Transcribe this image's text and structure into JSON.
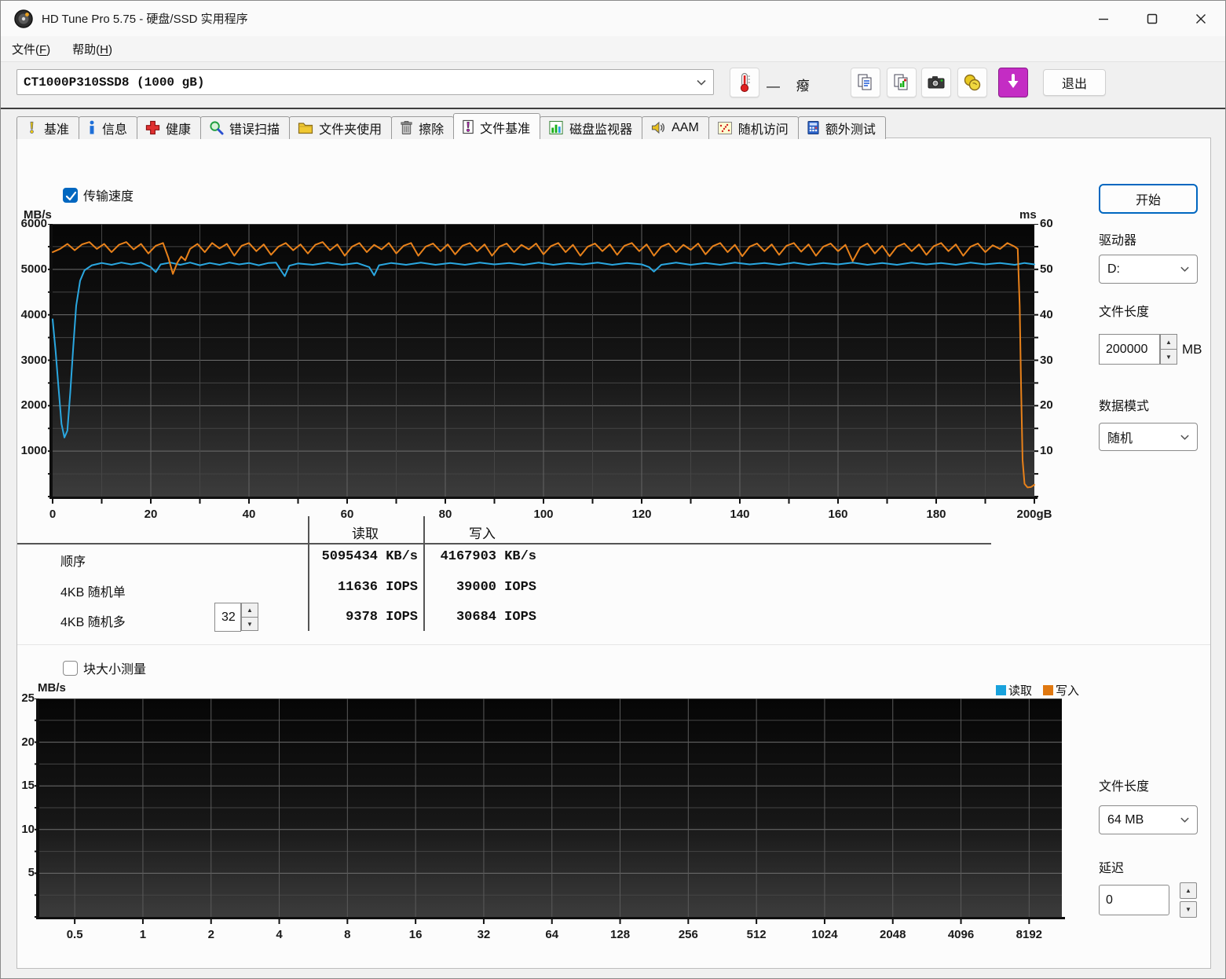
{
  "window": {
    "title": "HD Tune Pro 5.75 - 硬盘/SSD 实用程序"
  },
  "menu": {
    "items": [
      {
        "pre": "文件(",
        "key": "F",
        "post": ")"
      },
      {
        "pre": "帮助(",
        "key": "H",
        "post": ")"
      }
    ]
  },
  "toolbar": {
    "drive_select": "CT1000P310SSD8 (1000 gB)",
    "temp_text": "— 癈",
    "exit_label": "退出"
  },
  "tabs": {
    "active_index": 6,
    "items": [
      {
        "label": "基准"
      },
      {
        "label": "信息"
      },
      {
        "label": "健康"
      },
      {
        "label": "错误扫描"
      },
      {
        "label": "文件夹使用"
      },
      {
        "label": "擦除"
      },
      {
        "label": "文件基准"
      },
      {
        "label": "磁盘监视器"
      },
      {
        "label": "AAM"
      },
      {
        "label": "随机访问"
      },
      {
        "label": "额外测试"
      }
    ]
  },
  "benchmark": {
    "transfer_checkbox": "传输速度",
    "results": {
      "read_header": "读取",
      "write_header": "写入",
      "rows": [
        {
          "label": "顺序",
          "read": "5095434 KB/s",
          "write": "4167903 KB/s"
        },
        {
          "label": "4KB 随机单",
          "read": "11636 IOPS",
          "write": "39000 IOPS"
        },
        {
          "label": "4KB 随机多",
          "read": "9378 IOPS",
          "write": "30684 IOPS"
        }
      ],
      "queue_depth": "32"
    }
  },
  "blocksize_section": {
    "checkbox": "块大小测量"
  },
  "sidebar": {
    "start_label": "开始",
    "drive_label": "驱动器",
    "drive_value": "D:",
    "file_length_label": "文件长度",
    "file_length_value": "200000",
    "file_length_unit": "MB",
    "data_mode_label": "数据模式",
    "data_mode_value": "随机",
    "file_length2_label": "文件长度",
    "file_length2_value": "64 MB",
    "delay_label": "延迟",
    "delay_value": "0"
  },
  "colors": {
    "read_line": "#2aa7e0",
    "write_line": "#e8811a",
    "legend_read": "#19a2dc",
    "legend_write": "#e07810",
    "accent_blue": "#0067c0",
    "download_btn": "#c42cc4"
  },
  "chart_data": [
    {
      "id": "transfer",
      "type": "line",
      "title": "传输速度",
      "y_left": {
        "unit": "MB/s",
        "min": 0,
        "max": 6000,
        "minor_step": 500,
        "major_step": 1000,
        "ticks": [
          "6000",
          "5000",
          "4000",
          "3000",
          "2000",
          "1000"
        ]
      },
      "y_right": {
        "unit": "ms",
        "min": 0,
        "max": 60,
        "minor_step": 5,
        "ticks": [
          "60",
          "50",
          "40",
          "30",
          "20",
          "10"
        ]
      },
      "x": {
        "min": 0,
        "max": 200,
        "minor_step": 10,
        "major_step": 20,
        "ticks": [
          "0",
          "20",
          "40",
          "60",
          "80",
          "100",
          "120",
          "140",
          "160",
          "180",
          "200gB"
        ]
      },
      "legend_position": "none",
      "grid": true,
      "series": [
        {
          "name": "读取",
          "color": "#2aa7e0",
          "points": [
            [
              0,
              3900
            ],
            [
              0.6,
              3200
            ],
            [
              1.2,
              2400
            ],
            [
              1.8,
              1600
            ],
            [
              2.4,
              1300
            ],
            [
              3,
              1450
            ],
            [
              3.6,
              2300
            ],
            [
              4.2,
              3300
            ],
            [
              4.8,
              4200
            ],
            [
              5.6,
              4750
            ],
            [
              6.5,
              4980
            ],
            [
              8,
              5090
            ],
            [
              10,
              5140
            ],
            [
              12,
              5100
            ],
            [
              14,
              5150
            ],
            [
              16,
              5110
            ],
            [
              18,
              5150
            ],
            [
              20,
              5050
            ],
            [
              21,
              4940
            ],
            [
              22,
              5110
            ],
            [
              24,
              5150
            ],
            [
              26,
              5100
            ],
            [
              28,
              5150
            ],
            [
              30,
              5090
            ],
            [
              32,
              5140
            ],
            [
              34,
              5100
            ],
            [
              36,
              5150
            ],
            [
              38,
              5110
            ],
            [
              40,
              5140
            ],
            [
              42,
              5090
            ],
            [
              44,
              5140
            ],
            [
              45.5,
              5150
            ],
            [
              46.5,
              4980
            ],
            [
              47.3,
              4850
            ],
            [
              48.2,
              5080
            ],
            [
              50,
              5130
            ],
            [
              53,
              5100
            ],
            [
              56,
              5150
            ],
            [
              59,
              5100
            ],
            [
              62,
              5140
            ],
            [
              64.5,
              5050
            ],
            [
              65.5,
              4870
            ],
            [
              66.5,
              5090
            ],
            [
              69,
              5140
            ],
            [
              72,
              5100
            ],
            [
              75,
              5150
            ],
            [
              78,
              5100
            ],
            [
              81,
              5140
            ],
            [
              84,
              5100
            ],
            [
              87,
              5150
            ],
            [
              90,
              5110
            ],
            [
              93,
              5140
            ],
            [
              96,
              5100
            ],
            [
              99,
              5150
            ],
            [
              102,
              5100
            ],
            [
              105,
              5140
            ],
            [
              108,
              5110
            ],
            [
              111,
              5150
            ],
            [
              114,
              5100
            ],
            [
              117,
              5140
            ],
            [
              120,
              5110
            ],
            [
              121.5,
              5050
            ],
            [
              122.5,
              4950
            ],
            [
              124,
              5100
            ],
            [
              127,
              5150
            ],
            [
              130,
              5100
            ],
            [
              133,
              5140
            ],
            [
              136,
              5100
            ],
            [
              139,
              5150
            ],
            [
              142,
              5110
            ],
            [
              145,
              5140
            ],
            [
              148,
              5100
            ],
            [
              151,
              5150
            ],
            [
              154,
              5100
            ],
            [
              157,
              5140
            ],
            [
              160,
              5110
            ],
            [
              163,
              5150
            ],
            [
              166,
              5100
            ],
            [
              169,
              5140
            ],
            [
              172,
              5100
            ],
            [
              175,
              5150
            ],
            [
              178,
              5110
            ],
            [
              181,
              5140
            ],
            [
              184,
              5100
            ],
            [
              187,
              5150
            ],
            [
              190,
              5110
            ],
            [
              193,
              5140
            ],
            [
              196,
              5100
            ],
            [
              198,
              5140
            ],
            [
              200,
              5110
            ]
          ]
        },
        {
          "name": "写入",
          "color": "#e8811a",
          "points": [
            [
              0,
              5380
            ],
            [
              1.5,
              5450
            ],
            [
              3,
              5560
            ],
            [
              4.5,
              5420
            ],
            [
              6,
              5550
            ],
            [
              7.5,
              5600
            ],
            [
              9,
              5450
            ],
            [
              10.5,
              5560
            ],
            [
              12,
              5380
            ],
            [
              13.5,
              5540
            ],
            [
              15,
              5600
            ],
            [
              16.5,
              5440
            ],
            [
              18,
              5560
            ],
            [
              19.5,
              5350
            ],
            [
              21,
              5520
            ],
            [
              22.5,
              5580
            ],
            [
              23.6,
              5250
            ],
            [
              24.5,
              4900
            ],
            [
              25.4,
              5150
            ],
            [
              26.2,
              5280
            ],
            [
              27,
              5200
            ],
            [
              28,
              5450
            ],
            [
              29.5,
              5560
            ],
            [
              31,
              5380
            ],
            [
              32.5,
              5580
            ],
            [
              34,
              5460
            ],
            [
              35.5,
              5560
            ],
            [
              37,
              5300
            ],
            [
              38.5,
              5520
            ],
            [
              40,
              5580
            ],
            [
              41.5,
              5400
            ],
            [
              43,
              5550
            ],
            [
              44.5,
              5320
            ],
            [
              46,
              5500
            ],
            [
              47.5,
              5580
            ],
            [
              49,
              5420
            ],
            [
              50.5,
              5550
            ],
            [
              52,
              5350
            ],
            [
              53.5,
              5540
            ],
            [
              55,
              5600
            ],
            [
              56.5,
              5420
            ],
            [
              58,
              5550
            ],
            [
              59.5,
              5300
            ],
            [
              61,
              5500
            ],
            [
              62.5,
              5580
            ],
            [
              64,
              5380
            ],
            [
              65.5,
              5540
            ],
            [
              67,
              5440
            ],
            [
              68.5,
              5580
            ],
            [
              70,
              5350
            ],
            [
              71.5,
              5520
            ],
            [
              73,
              5580
            ],
            [
              74.5,
              5300
            ],
            [
              76,
              5500
            ],
            [
              77.5,
              5570
            ],
            [
              79,
              5400
            ],
            [
              80.5,
              5550
            ],
            [
              82,
              5330
            ],
            [
              83.5,
              5520
            ],
            [
              85,
              5580
            ],
            [
              86.5,
              5400
            ],
            [
              88,
              5550
            ],
            [
              89.5,
              5300
            ],
            [
              91,
              5500
            ],
            [
              92.5,
              5570
            ],
            [
              94,
              5380
            ],
            [
              95.5,
              5540
            ],
            [
              97,
              5440
            ],
            [
              98.5,
              5570
            ],
            [
              100,
              5330
            ],
            [
              101.5,
              5510
            ],
            [
              103,
              5580
            ],
            [
              104.5,
              5380
            ],
            [
              106,
              5540
            ],
            [
              107.5,
              5300
            ],
            [
              109,
              5500
            ],
            [
              110.5,
              5570
            ],
            [
              112,
              5400
            ],
            [
              113.5,
              5550
            ],
            [
              115,
              5320
            ],
            [
              116.5,
              5520
            ],
            [
              118,
              5580
            ],
            [
              119.5,
              5400
            ],
            [
              121,
              5550
            ],
            [
              122.5,
              5300
            ],
            [
              124,
              5500
            ],
            [
              125.5,
              5570
            ],
            [
              127,
              5380
            ],
            [
              128.5,
              5540
            ],
            [
              130,
              5430
            ],
            [
              131.5,
              5570
            ],
            [
              133,
              5330
            ],
            [
              134.5,
              5510
            ],
            [
              136,
              5580
            ],
            [
              137.5,
              5380
            ],
            [
              139,
              5540
            ],
            [
              140.5,
              5290
            ],
            [
              142,
              5500
            ],
            [
              143.5,
              5570
            ],
            [
              145,
              5400
            ],
            [
              146.5,
              5550
            ],
            [
              148,
              5320
            ],
            [
              149.5,
              5520
            ],
            [
              151,
              5580
            ],
            [
              152.5,
              5390
            ],
            [
              154,
              5550
            ],
            [
              155.5,
              5300
            ],
            [
              157,
              5500
            ],
            [
              158.5,
              5570
            ],
            [
              160,
              5400
            ],
            [
              161.5,
              5540
            ],
            [
              163,
              5180
            ],
            [
              164.5,
              5480
            ],
            [
              166,
              5570
            ],
            [
              167.5,
              5350
            ],
            [
              169,
              5520
            ],
            [
              170.5,
              5290
            ],
            [
              172,
              5500
            ],
            [
              173.5,
              5570
            ],
            [
              175,
              5400
            ],
            [
              176.5,
              5550
            ],
            [
              178,
              5320
            ],
            [
              179.5,
              5510
            ],
            [
              181,
              5580
            ],
            [
              182.5,
              5400
            ],
            [
              184,
              5550
            ],
            [
              185.5,
              5300
            ],
            [
              187,
              5500
            ],
            [
              188.5,
              5570
            ],
            [
              190,
              5380
            ],
            [
              191.5,
              5530
            ],
            [
              193,
              5450
            ],
            [
              194.5,
              5580
            ],
            [
              196,
              5500
            ],
            [
              196.6,
              5450
            ],
            [
              197,
              4200
            ],
            [
              197.3,
              2400
            ],
            [
              197.6,
              800
            ],
            [
              198,
              280
            ],
            [
              198.6,
              200
            ],
            [
              199.3,
              210
            ],
            [
              200,
              260
            ]
          ]
        }
      ]
    },
    {
      "id": "blocksize",
      "type": "line",
      "title": "块大小测量",
      "y_left": {
        "unit": "MB/s",
        "min": 0,
        "max": 25,
        "minor_step": 2.5,
        "major_step": 5,
        "ticks": [
          "25",
          "20",
          "15",
          "10",
          "5"
        ]
      },
      "x_categories": [
        "0.5",
        "1",
        "2",
        "4",
        "8",
        "16",
        "32",
        "64",
        "128",
        "256",
        "512",
        "1024",
        "2048",
        "4096",
        "8192"
      ],
      "legend": [
        {
          "label": "读取",
          "color": "#19a2dc"
        },
        {
          "label": "写入",
          "color": "#e07810"
        }
      ],
      "legend_position": "top-right",
      "grid": true,
      "series": []
    }
  ]
}
